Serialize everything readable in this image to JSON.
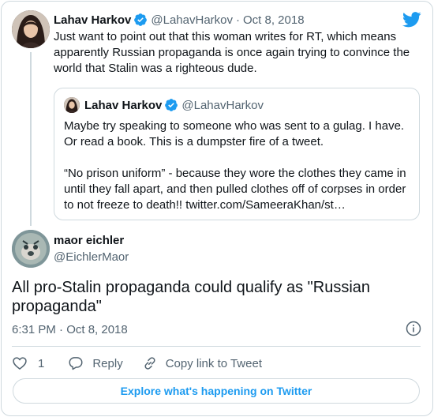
{
  "parent_tweet": {
    "author_name": "Lahav Harkov",
    "handle": "@LahavHarkov",
    "separator": "·",
    "date": "Oct 8, 2018",
    "text": "Just want to point out that this woman writes for RT, which means apparently Russian propaganda is once again trying to convince the world that Stalin  was a righteous dude."
  },
  "quoted_tweet": {
    "author_name": "Lahav Harkov",
    "handle": "@LahavHarkov",
    "paragraph_1": "Maybe try speaking to someone who was sent to a gulag. I have. Or read a book. This is a dumpster fire of a tweet.",
    "paragraph_2": "“No prison uniform” - because they wore the clothes they came in until they fall apart, and then pulled clothes off of corpses in order to not freeze to death!! twitter.com/SameeraKhan/st…"
  },
  "main_tweet": {
    "author_name": "maor eichler",
    "handle": "@EichlerMaor",
    "text": "All pro-Stalin propaganda could qualify as \"Russian propaganda\"",
    "timestamp": "6:31 PM · Oct 8, 2018"
  },
  "actions": {
    "like_count": "1",
    "reply_label": "Reply",
    "copy_label": "Copy link to Tweet"
  },
  "footer": {
    "explore_label": "Explore what's happening on Twitter"
  },
  "icons": {
    "verified": "verified-badge-icon",
    "brand": "twitter-bird-icon",
    "info": "info-icon",
    "like": "heart-icon",
    "reply": "speech-bubble-icon",
    "copy": "link-icon"
  },
  "colors": {
    "accent": "#1d9bf0",
    "text": "#0f1419",
    "secondary": "#536471",
    "border": "#cfd9de"
  }
}
